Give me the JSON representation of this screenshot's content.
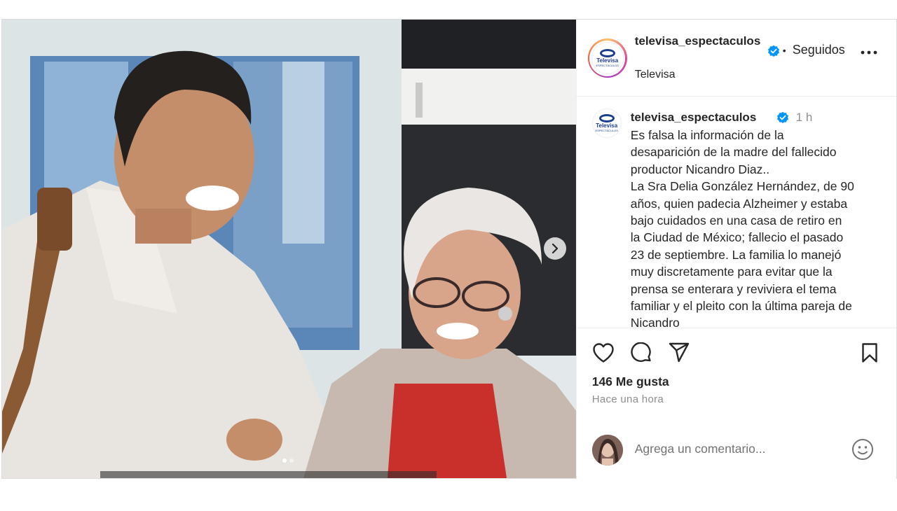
{
  "post": {
    "header": {
      "username": "televisa_espectaculos",
      "separator": "•",
      "follow_state": "Seguidos",
      "subtitle": "Televisa",
      "logo_word": "Televisa",
      "logo_sub": "ESPECTÁCULOS"
    },
    "caption": {
      "username": "televisa_espectaculos",
      "time": "1 h",
      "text": "Es falsa la información de la\ndesaparición  de la madre del fallecido\nproductor Nicandro Diaz..\nLa Sra Delia González Hernández, de 90\naños, quien padecia Alzheimer y estaba\nbajo cuidados en una casa de retiro en\nla Ciudad de México; fallecio el pasado\n23 de septiembre.  La familia lo manejó\nmuy discretamente para evitar que la\nprensa se enterara y reviviera el tema\nfamiliar y el pleito con la última pareja de\nNicandro"
    },
    "stats": {
      "likes": "146 Me gusta",
      "posted_ago": "Hace una hora"
    },
    "comment": {
      "placeholder": "Agrega un comentario..."
    },
    "carousel": {
      "slides": 2,
      "active_index": 0
    },
    "icons": {
      "verified": "verified-badge-icon",
      "more": "more-options-icon",
      "next": "chevron-right-icon",
      "like": "heart-icon",
      "comment": "comment-icon",
      "share": "share-icon",
      "save": "bookmark-icon",
      "emoji": "emoji-icon"
    },
    "colors": {
      "verified_blue": "#0095f6",
      "text": "#262626",
      "muted": "#8e8e8e"
    }
  }
}
